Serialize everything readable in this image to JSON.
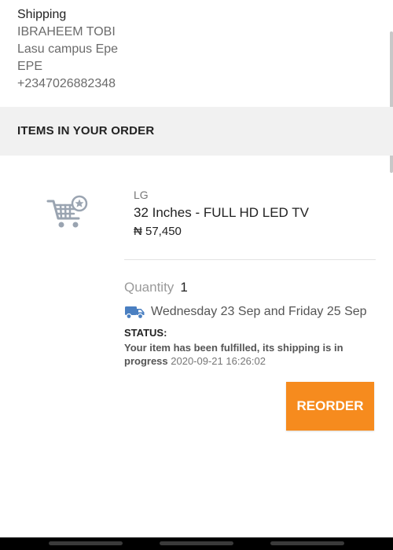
{
  "shipping": {
    "title": "Shipping",
    "name": "IBRAHEEM TOBI",
    "address_line1": "Lasu campus Epe",
    "address_line2": "EPE",
    "phone": "+2347026882348"
  },
  "order": {
    "section_title": "ITEMS IN YOUR ORDER",
    "item": {
      "brand": "LG",
      "name": "32 Inches - FULL HD LED TV",
      "price": "₦ 57,450",
      "image_icon": "shopping-cart-star-icon",
      "quantity_label": "Quantity",
      "quantity": "1",
      "delivery_icon": "delivery-truck-icon",
      "delivery_window": "Wednesday 23 Sep and Friday 25 Sep",
      "status_label": "STATUS:",
      "status_message": "Your item has been fulfilled, its shipping is in progress",
      "status_time": "2020-09-21 16:26:02"
    },
    "reorder_label": "REORDER"
  },
  "colors": {
    "accent": "#f68b1e",
    "section_background": "#f1f1f1",
    "truck_blue": "#4a7fc1",
    "cart_gray": "#9aa4b1"
  }
}
